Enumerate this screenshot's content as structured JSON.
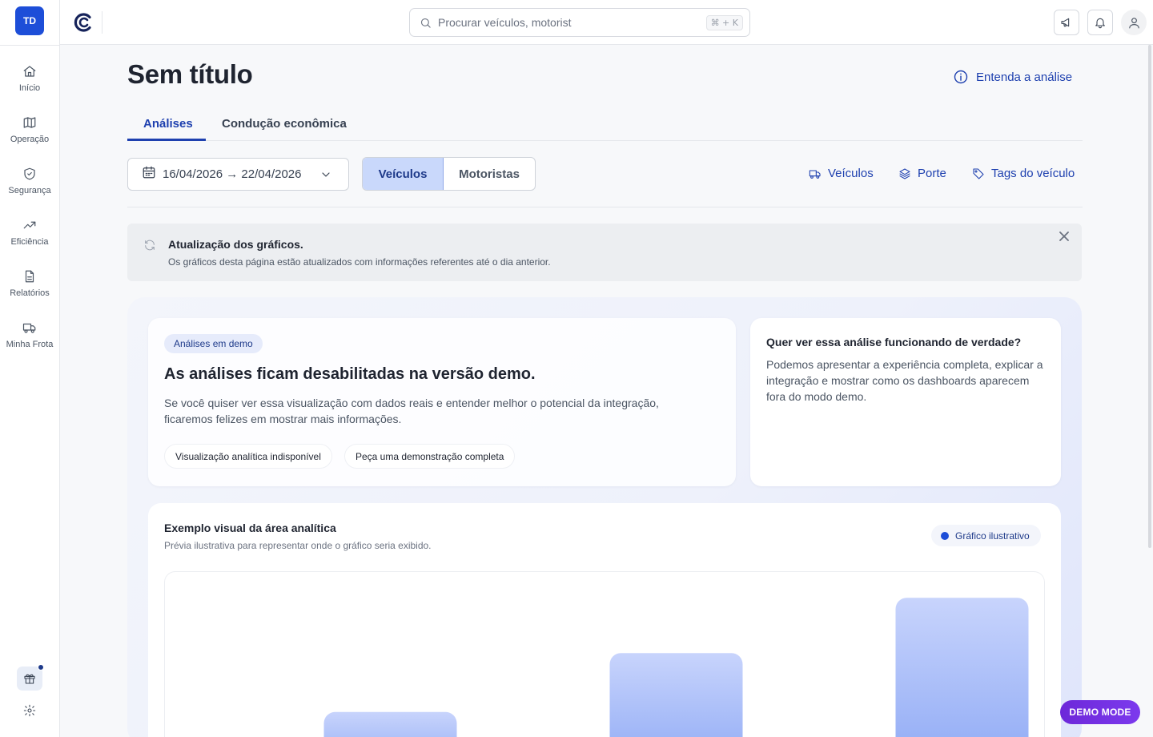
{
  "sidebar": {
    "avatar": "TD",
    "items": [
      {
        "label": "Início",
        "icon": "home-icon"
      },
      {
        "label": "Operação",
        "icon": "map-icon"
      },
      {
        "label": "Segurança",
        "icon": "shield-check-icon"
      },
      {
        "label": "Eficiência",
        "icon": "trending-up-icon"
      },
      {
        "label": "Relatórios",
        "icon": "file-icon"
      },
      {
        "label": "Minha Frota",
        "icon": "truck-icon"
      }
    ],
    "footer_icons": [
      "gift-icon",
      "gear-icon"
    ]
  },
  "topbar": {
    "search_placeholder": "Procurar veículos, motorist",
    "shortcut": "⌘ + K",
    "icons": [
      "megaphone-icon",
      "bell-icon",
      "user-icon"
    ]
  },
  "page": {
    "title": "Sem título",
    "help_link": "Entenda a análise"
  },
  "tabs": [
    {
      "label": "Análises",
      "active": true
    },
    {
      "label": "Condução econômica",
      "active": false
    }
  ],
  "filters": {
    "date_range": "16/04/2026 → 22/04/2026",
    "segment": [
      {
        "label": "Veículos",
        "active": true
      },
      {
        "label": "Motoristas",
        "active": false
      }
    ],
    "links": [
      {
        "label": "Veículos",
        "icon": "truck-icon"
      },
      {
        "label": "Porte",
        "icon": "layers-icon"
      },
      {
        "label": "Tags do veículo",
        "icon": "tag-icon"
      }
    ]
  },
  "notice": {
    "title": "Atualização dos gráficos.",
    "text": "Os gráficos desta página estão atualizados com informações referentes até o dia anterior."
  },
  "demo": {
    "chip": "Análises em demo",
    "title": "As análises ficam desabilitadas na versão demo.",
    "text": "Se você quiser ver essa visualização com dados reais e entender melhor o potencial da integração, ficaremos felizes em mostrar mais informações.",
    "pills": [
      "Visualização analítica indisponível",
      "Peça uma demonstração completa"
    ],
    "side_title": "Quer ver essa análise funcionando de verdade?",
    "side_text": "Podemos apresentar a experiência completa, explicar a integração e mostrar como os dashboards aparecem fora do modo demo."
  },
  "chart_section": {
    "title": "Exemplo visual da área analítica",
    "subtitle": "Prévia ilustrativa para representar onde o gráfico seria exibido.",
    "legend": "Gráfico ilustrativo"
  },
  "chart_data": {
    "type": "bar",
    "categories": [
      "",
      "",
      "",
      "",
      "",
      ""
    ],
    "values": [
      0,
      12,
      0,
      28,
      4,
      43
    ],
    "colors": {
      "bar_top": "#c8d4fc",
      "bar_bottom": "#8ea9f5"
    }
  },
  "badge": "DEMO MODE",
  "colors": {
    "accent": "#1e40af",
    "primary": "#1d4ed8",
    "demo_badge": "#7c3aed"
  }
}
